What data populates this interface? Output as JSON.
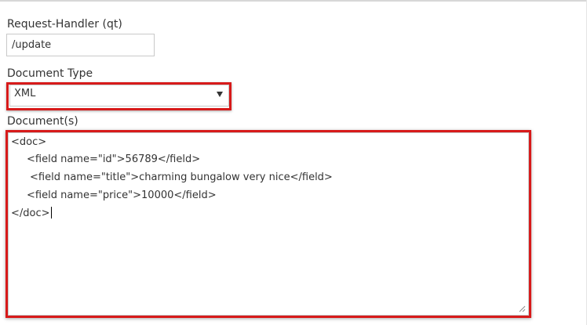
{
  "form": {
    "request_handler": {
      "label": "Request-Handler (qt)",
      "value": "/update"
    },
    "document_type": {
      "label": "Document Type",
      "selected": "XML",
      "highlight_color": "#d71a1a"
    },
    "documents": {
      "label": "Document(s)",
      "lines": [
        "<doc>",
        "<field name=\"id\">56789</field>",
        "<field name=\"title\">charming bungalow very nice</field>",
        "<field name=\"price\">10000</field>",
        "</doc>"
      ],
      "highlight_color": "#d71a1a"
    }
  },
  "icons": {
    "select_arrow": "chevron-down-icon",
    "textarea_resize": "resize-grip-icon"
  }
}
